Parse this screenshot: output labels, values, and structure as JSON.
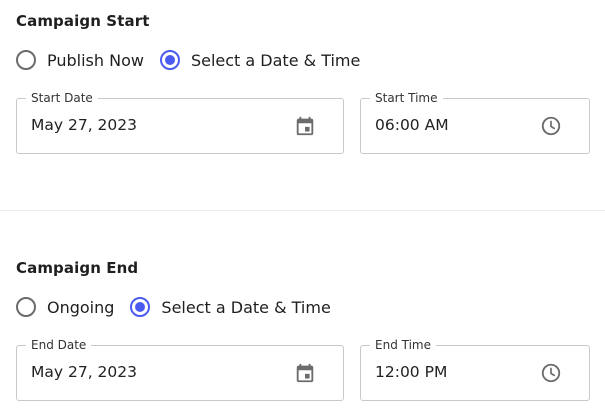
{
  "campaign_start": {
    "title": "Campaign Start",
    "options": [
      {
        "label": "Publish Now",
        "selected": false
      },
      {
        "label": "Select a Date & Time",
        "selected": true
      }
    ],
    "date_field": {
      "label": "Start Date",
      "value": "May 27, 2023",
      "icon": "calendar-icon"
    },
    "time_field": {
      "label": "Start Time",
      "value": "06:00 AM",
      "icon": "clock-icon"
    }
  },
  "campaign_end": {
    "title": "Campaign End",
    "options": [
      {
        "label": "Ongoing",
        "selected": false
      },
      {
        "label": "Select a Date & Time",
        "selected": true
      }
    ],
    "date_field": {
      "label": "End Date",
      "value": "May 27, 2023",
      "icon": "calendar-icon"
    },
    "time_field": {
      "label": "End Time",
      "value": "12:00 PM",
      "icon": "clock-icon"
    }
  },
  "colors": {
    "accent": "#4a5cf0",
    "border": "#c9c9c9",
    "icon": "#6b6b6b"
  }
}
